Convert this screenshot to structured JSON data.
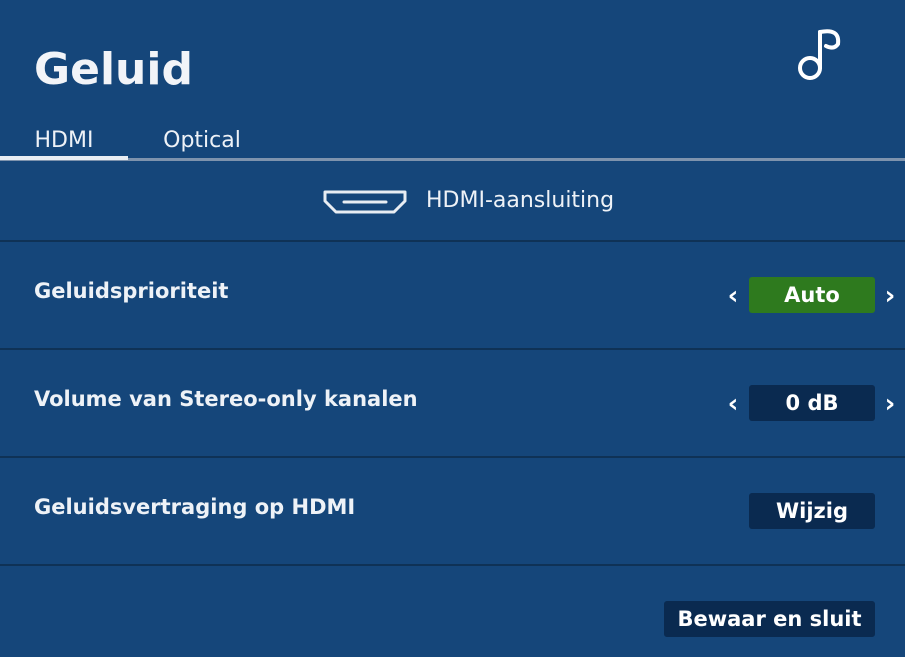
{
  "header": {
    "title": "Geluid",
    "icon": "music-note-icon"
  },
  "tabs": [
    {
      "label": "HDMI",
      "active": true
    },
    {
      "label": "Optical",
      "active": false
    }
  ],
  "source": {
    "icon": "hdmi-port-icon",
    "label": "HDMI-aansluiting"
  },
  "settings": {
    "sound_priority": {
      "label": "Geluidsprioriteit",
      "value": "Auto",
      "value_color": "#2e7a1e"
    },
    "stereo_volume": {
      "label": "Volume van Stereo-only kanalen",
      "value": "0 dB"
    },
    "hdmi_delay": {
      "label": "Geluidsvertraging op HDMI",
      "button": "Wijzig"
    }
  },
  "footer": {
    "save_button": "Bewaar en sluit"
  },
  "colors": {
    "background": "#15467a",
    "selector_active": "#2e7a1e",
    "control_dark": "#0a2a50"
  }
}
